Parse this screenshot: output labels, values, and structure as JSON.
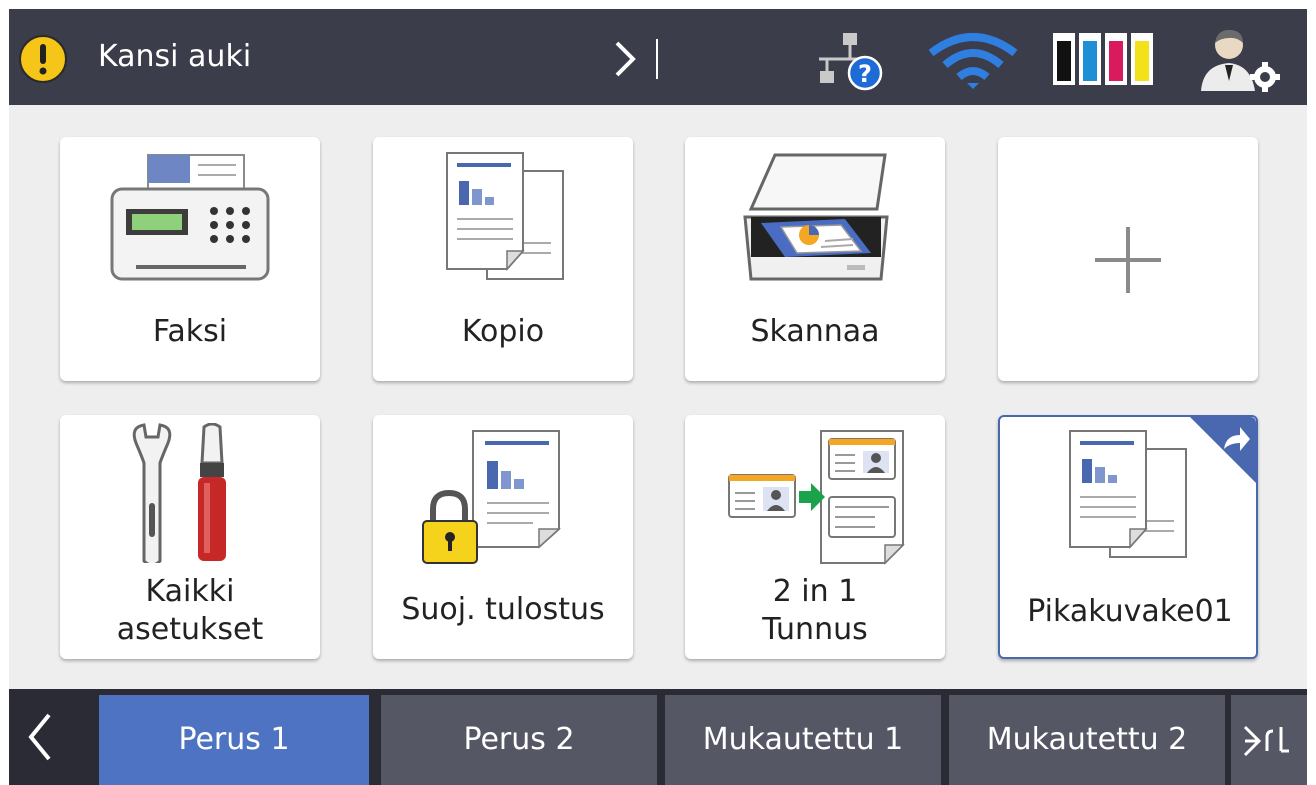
{
  "status_bar": {
    "alert_icon": "warning-exclamation-icon",
    "message": "Kansi auki",
    "chevron_icon": "chevron-right-icon",
    "network_icon": "wired-network-unknown-icon",
    "wifi_icon": "wifi-icon",
    "ink_icon": "ink-levels-icon",
    "admin_icon": "admin-settings-icon",
    "ink_colors": [
      "#111111",
      "#1e8fd6",
      "#d91a5d",
      "#f3e21a"
    ]
  },
  "tiles": [
    {
      "label": "Faksi",
      "icon": "fax-icon"
    },
    {
      "label": "Kopio",
      "icon": "copy-icon"
    },
    {
      "label": "Skannaa",
      "icon": "scan-icon"
    },
    {
      "label": "",
      "icon": "plus-icon"
    },
    {
      "label_line1": "Kaikki",
      "label_line2": "asetukset",
      "icon": "tools-icon"
    },
    {
      "label": "Suoj. tulostus",
      "icon": "secure-print-icon"
    },
    {
      "label_line1": "2 in 1",
      "label_line2": "Tunnus",
      "icon": "id-copy-icon"
    },
    {
      "label": "Pikakuvake01",
      "icon": "shortcut-icon"
    }
  ],
  "tabs": [
    {
      "label": "Perus 1",
      "active": true
    },
    {
      "label": "Perus 2",
      "active": false
    },
    {
      "label": "Mukautettu 1",
      "active": false
    },
    {
      "label": "Mukautettu 2",
      "active": false
    }
  ],
  "colors": {
    "status_bg": "#3c3d4a",
    "main_bg": "#eeeeee",
    "tab_active": "#4e73c2",
    "tab_inactive": "#555764",
    "accent_blue": "#4a68b0",
    "alert_yellow": "#f5c518"
  }
}
